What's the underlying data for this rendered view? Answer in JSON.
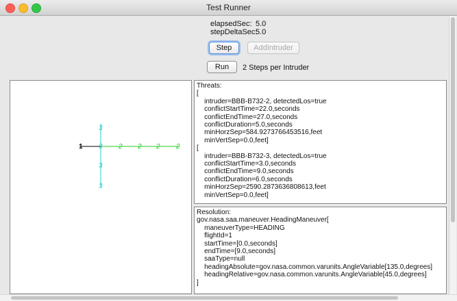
{
  "window": {
    "title": "Test Runner"
  },
  "stats": {
    "elapsed_label": "elapsedSec:",
    "elapsed_value": "5.0",
    "step_delta_label": "stepDeltaSec:",
    "step_delta_value": "5.0"
  },
  "buttons": {
    "step": "Step",
    "add_intruder": "AddIntruder",
    "run": "Run"
  },
  "run_info": "2 Steps per Intruder",
  "threats_text": "Threats:\n[\n    intruder=BBB-B732-2, detectedLos=true\n    conflictStartTime=22.0,seconds\n    conflictEndTime=27.0,seconds\n    conflictDuration=5.0,seconds\n    minHorzSep=584.9273766453516,feet\n    minVertSep=0.0,feet]\n[\n    intruder=BBB-B732-3, detectedLos=true\n    conflictStartTime=3.0,seconds\n    conflictEndTime=9.0,seconds\n    conflictDuration=6.0,seconds\n    minHorzSep=2590.2873636808613,feet\n    minVertSep=0.0,feet]",
  "resolution_text": "Resolution:\ngov.nasa.saa.maneuver.HeadingManeuver[\n    maneuverType=HEADING\n    flightId=1\n    startTime=[0.0,seconds]\n    endTime=[9.0,seconds]\n    saaType=null\n    headingAbsolute=gov.nasa.common.varunits.AngleVariable[135.0,degrees]\n    headingRelative=gov.nasa.common.varunits.AngleVariable[45.0,degrees]\n]",
  "plot": {
    "labels": {
      "ownship": "1",
      "intruder2": "2",
      "intruder3": "3"
    },
    "colors": {
      "ownship": "#000000",
      "intruder2": "#22cc22",
      "intruder3": "#22cccc"
    }
  }
}
